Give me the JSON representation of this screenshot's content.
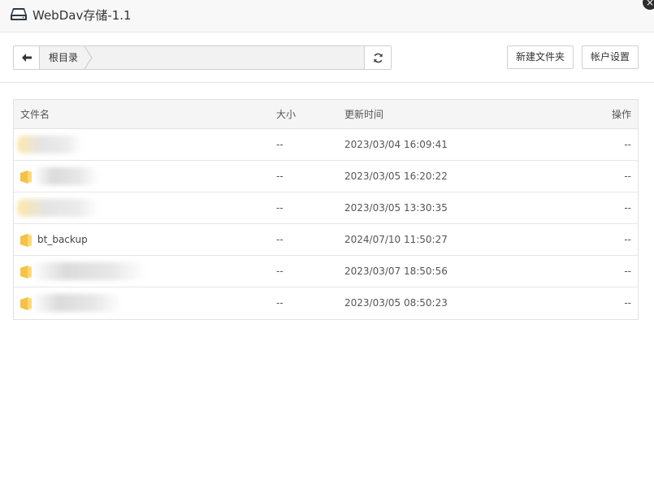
{
  "window": {
    "title": "WebDav存储-1.1",
    "close_label": "×"
  },
  "nav": {
    "breadcrumb": [
      "根目录"
    ]
  },
  "toolbar": {
    "new_folder_label": "新建文件夹",
    "account_settings_label": "帐户设置"
  },
  "table": {
    "columns": [
      "文件名",
      "大小",
      "更新时间",
      "操作"
    ],
    "rows": [
      {
        "name": "",
        "size": "--",
        "time": "2023/03/04 16:09:41",
        "ops": "--"
      },
      {
        "name": "",
        "size": "--",
        "time": "2023/03/05 16:20:22",
        "ops": "--"
      },
      {
        "name": "",
        "size": "--",
        "time": "2023/03/05 13:30:35",
        "ops": "--"
      },
      {
        "name": "bt_backup",
        "size": "--",
        "time": "2024/07/10 11:50:27",
        "ops": "--"
      },
      {
        "name": "",
        "size": "--",
        "time": "2023/03/07 18:50:56",
        "ops": "--"
      },
      {
        "name": "",
        "size": "--",
        "time": "2023/03/05 08:50:23",
        "ops": "--"
      }
    ]
  },
  "colors": {
    "folder": "#f5c244",
    "folder_light": "#fbd978",
    "icon_dark": "#2f3a45"
  }
}
